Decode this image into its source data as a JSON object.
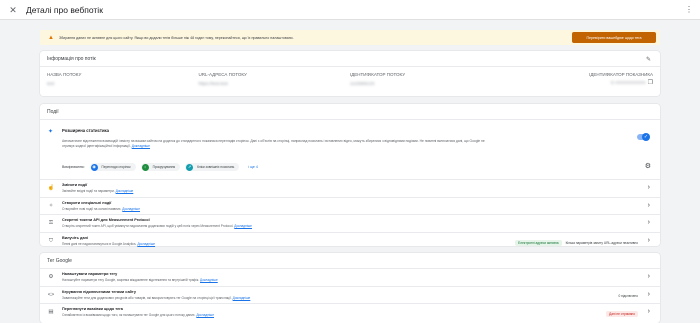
{
  "header": {
    "title": "Деталі про вебпотік"
  },
  "banner": {
    "text": "Збирання даних не активне для цього сайту. Якщо ви додали тегів більше ніж 48 годин тому, переконайтеся, що їх правильно налаштовано.",
    "button": "Перевірити вашебдюе щодо тега"
  },
  "stream": {
    "heading": "Інформація про потік",
    "fields": [
      {
        "label": "НАЗВА ПОТОКУ",
        "value": "test"
      },
      {
        "label": "URL-АДРЕСА ПОТОКУ",
        "value": "https://test.test"
      },
      {
        "label": "ІДЕНТИФІКАТОР ПОТОКУ",
        "value": "1115968133"
      },
      {
        "label": "ІДЕНТИФІКАТОР ПОКАЗНИКА",
        "value": "G-XXXXXXXXXX"
      }
    ]
  },
  "events": {
    "heading": "Події",
    "enhanced": {
      "title": "Розширена статистика",
      "description": "Автоматичне відстеження взаємодій і вмісту на вашим сайтом на додаток до стандартного показника переглядів сторінок. Дані з об'єктів на сторінці, наприклад посилань і вставлених відео, можуть збиратися з відповідними подіями. Не повинні включатися дані, що Google не отримує жодної ідентифікаційної інформації.",
      "more": "Докладніше",
      "measuring_label": "Вимірювання:",
      "chips": [
        "Перегляди сторінок",
        "Прокручування",
        "Кліки зовнішніх посилань"
      ],
      "more_count": "і ще 4"
    },
    "rows": [
      {
        "title": "Змінити події",
        "desc": "Змінюйте вхідні події та параметри.",
        "link": "Докладніше"
      },
      {
        "title": "Створити спеціальні події",
        "desc": "Створюйте нові події на основі наявних.",
        "link": "Докладніше"
      },
      {
        "title": "Секретні токени API для Measurement Protocol",
        "desc": "Створіть секретний токен API, щоб увімкнути надсилання додаткових подій у цей потік через Measurement Protocol.",
        "link": "Докладніше"
      },
      {
        "title": "Вилучіть дані",
        "desc": "Певні дані не надсилатимуться в Google Analytics.",
        "link": "Докладніше",
        "badge": "Електронні адреси активна",
        "status": "Кілька параметрів запиту URL-адреси неактивно"
      }
    ]
  },
  "google_tag": {
    "heading": "Тег Google",
    "rows": [
      {
        "title": "Налаштувати параметри тегу",
        "desc": "Налаштуйте параметри тегу Google, зокрема міждоменне відстеження та внутрішній трафік.",
        "link": "Докладніше"
      },
      {
        "title": "Керування підключеними тегами сайту",
        "desc": "Завантажуйте теги для додаткових ресурсів або товарів, які використовують тег Google на сторінці цієї трансляції.",
        "link": "Докладніше",
        "status": "0 підключено"
      },
      {
        "title": "Переглянути вказівки щодо тега",
        "desc": "Ознайомтеся із вказівками щодо того, як налаштувати тег Google для цього потоку даних.",
        "link": "Докладніше",
        "badge": "Дані не отримано"
      }
    ]
  }
}
